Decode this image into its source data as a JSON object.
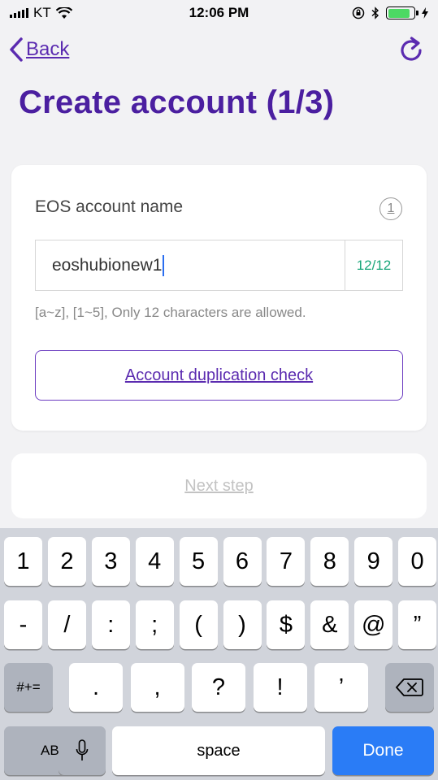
{
  "status_bar": {
    "carrier": "KT",
    "time": "12:06 PM",
    "battery_level": 0.85,
    "battery_color": "#4cd964"
  },
  "nav": {
    "back_label": "Back",
    "back_icon": "chevron-left-icon",
    "refresh_icon": "refresh-icon"
  },
  "page": {
    "title": "Create account (1/3)"
  },
  "account_card": {
    "label": "EOS account name",
    "step_badge": "1",
    "input_value": "eoshubionew1",
    "counter": "12/12",
    "hint": "[a~z], [1~5], Only 12 characters are allowed.",
    "duplication_button": "Account duplication check"
  },
  "next_step_label": "Next step",
  "keyboard": {
    "row1": [
      "1",
      "2",
      "3",
      "4",
      "5",
      "6",
      "7",
      "8",
      "9",
      "0"
    ],
    "row2": [
      "-",
      "/",
      ":",
      ";",
      "(",
      ")",
      "$",
      "&",
      "@",
      "”"
    ],
    "row3_toggle": "#+=",
    "row3": [
      ".",
      ",",
      "?",
      "!",
      "’"
    ],
    "abc_label": "ABC",
    "space_label": "space",
    "done_label": "Done"
  },
  "colors": {
    "accent": "#5b2bb0",
    "title": "#4b1fa0",
    "counter": "#1aa67a",
    "done_key": "#2a7cf6"
  }
}
